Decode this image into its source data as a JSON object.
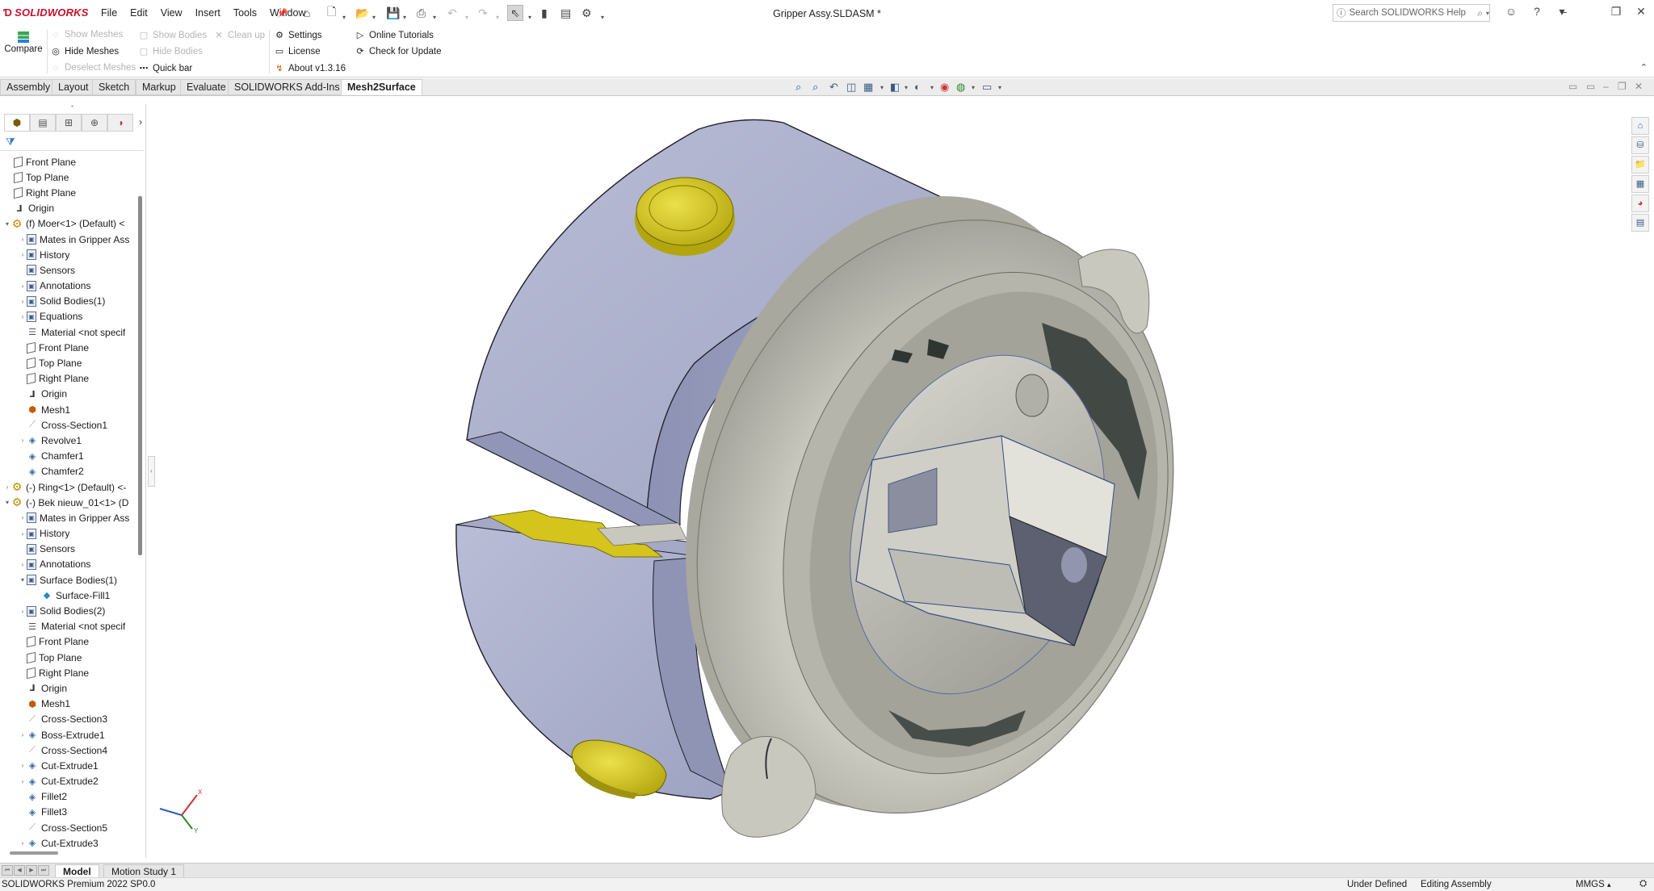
{
  "app": {
    "logo_text": "SOLIDWORKS",
    "document_title": "Gripper Assy.SLDASM *"
  },
  "menu": [
    "File",
    "Edit",
    "View",
    "Insert",
    "Tools",
    "Window"
  ],
  "search": {
    "placeholder": "Search SOLIDWORKS Help"
  },
  "ribbon": {
    "compare_label": "Compare",
    "show_meshes": "Show Meshes",
    "hide_meshes": "Hide Meshes",
    "deselect_meshes": "Deselect Meshes",
    "show_bodies": "Show Bodies",
    "hide_bodies": "Hide Bodies",
    "quick_bar": "Quick bar",
    "clean_up": "Clean up",
    "settings": "Settings",
    "license": "License",
    "about": "About v1.3.16",
    "online_tutorials": "Online Tutorials",
    "check_update": "Check for Update"
  },
  "tabs": [
    "Assembly",
    "Layout",
    "Sketch",
    "Markup",
    "Evaluate",
    "SOLIDWORKS Add-Ins",
    "Mesh2Surface"
  ],
  "active_tab": "Mesh2Surface",
  "tree": [
    {
      "label": "Front Plane",
      "icon": "plane",
      "indent": 1,
      "toggle": ""
    },
    {
      "label": "Top Plane",
      "icon": "plane",
      "indent": 1,
      "toggle": ""
    },
    {
      "label": "Right Plane",
      "icon": "plane",
      "indent": 1,
      "toggle": ""
    },
    {
      "label": "Origin",
      "icon": "origin",
      "indent": 1,
      "toggle": ""
    },
    {
      "label": "(f) Moer<1> (Default) <",
      "icon": "component",
      "indent": 0,
      "toggle": "▾"
    },
    {
      "label": "Mates in Gripper Ass",
      "icon": "folder",
      "indent": 2,
      "toggle": "›"
    },
    {
      "label": "History",
      "icon": "folder",
      "indent": 2,
      "toggle": "›"
    },
    {
      "label": "Sensors",
      "icon": "folder",
      "indent": 2,
      "toggle": ""
    },
    {
      "label": "Annotations",
      "icon": "folder",
      "indent": 2,
      "toggle": "›"
    },
    {
      "label": "Solid Bodies(1)",
      "icon": "folder",
      "indent": 2,
      "toggle": "›"
    },
    {
      "label": "Equations",
      "icon": "folder",
      "indent": 2,
      "toggle": "›"
    },
    {
      "label": "Material <not specif",
      "icon": "material",
      "indent": 2,
      "toggle": ""
    },
    {
      "label": "Front Plane",
      "icon": "plane",
      "indent": 2,
      "toggle": ""
    },
    {
      "label": "Top Plane",
      "icon": "plane",
      "indent": 2,
      "toggle": ""
    },
    {
      "label": "Right Plane",
      "icon": "plane",
      "indent": 2,
      "toggle": ""
    },
    {
      "label": "Origin",
      "icon": "origin",
      "indent": 2,
      "toggle": ""
    },
    {
      "label": "Mesh1",
      "icon": "mesh",
      "indent": 2,
      "toggle": ""
    },
    {
      "label": "Cross-Section1",
      "icon": "cross-section",
      "indent": 2,
      "toggle": ""
    },
    {
      "label": "Revolve1",
      "icon": "feature",
      "indent": 2,
      "toggle": "›"
    },
    {
      "label": "Chamfer1",
      "icon": "feature",
      "indent": 2,
      "toggle": ""
    },
    {
      "label": "Chamfer2",
      "icon": "feature",
      "indent": 2,
      "toggle": ""
    },
    {
      "label": "(-) Ring<1> (Default) <-",
      "icon": "component",
      "indent": 0,
      "toggle": "›"
    },
    {
      "label": "(-) Bek nieuw_01<1> (D",
      "icon": "component",
      "indent": 0,
      "toggle": "▾"
    },
    {
      "label": "Mates in Gripper Ass",
      "icon": "folder",
      "indent": 2,
      "toggle": "›"
    },
    {
      "label": "History",
      "icon": "folder",
      "indent": 2,
      "toggle": "›"
    },
    {
      "label": "Sensors",
      "icon": "folder",
      "indent": 2,
      "toggle": ""
    },
    {
      "label": "Annotations",
      "icon": "folder",
      "indent": 2,
      "toggle": "›"
    },
    {
      "label": "Surface Bodies(1)",
      "icon": "folder",
      "indent": 2,
      "toggle": "▾"
    },
    {
      "label": "Surface-Fill1",
      "icon": "surface",
      "indent": 3,
      "toggle": ""
    },
    {
      "label": "Solid Bodies(2)",
      "icon": "folder",
      "indent": 2,
      "toggle": "›"
    },
    {
      "label": "Material <not specif",
      "icon": "material",
      "indent": 2,
      "toggle": ""
    },
    {
      "label": "Front Plane",
      "icon": "plane",
      "indent": 2,
      "toggle": ""
    },
    {
      "label": "Top Plane",
      "icon": "plane",
      "indent": 2,
      "toggle": ""
    },
    {
      "label": "Right Plane",
      "icon": "plane",
      "indent": 2,
      "toggle": ""
    },
    {
      "label": "Origin",
      "icon": "origin",
      "indent": 2,
      "toggle": ""
    },
    {
      "label": "Mesh1",
      "icon": "mesh",
      "indent": 2,
      "toggle": ""
    },
    {
      "label": "Cross-Section3",
      "icon": "cross-section",
      "indent": 2,
      "toggle": ""
    },
    {
      "label": "Boss-Extrude1",
      "icon": "feature",
      "indent": 2,
      "toggle": "›"
    },
    {
      "label": "Cross-Section4",
      "icon": "cross-section",
      "indent": 2,
      "toggle": ""
    },
    {
      "label": "Cut-Extrude1",
      "icon": "feature",
      "indent": 2,
      "toggle": "›"
    },
    {
      "label": "Cut-Extrude2",
      "icon": "feature",
      "indent": 2,
      "toggle": "›"
    },
    {
      "label": "Fillet2",
      "icon": "feature",
      "indent": 2,
      "toggle": ""
    },
    {
      "label": "Fillet3",
      "icon": "feature",
      "indent": 2,
      "toggle": ""
    },
    {
      "label": "Cross-Section5",
      "icon": "cross-section",
      "indent": 2,
      "toggle": ""
    },
    {
      "label": "Cut-Extrude3",
      "icon": "feature",
      "indent": 2,
      "toggle": "›"
    }
  ],
  "bottom_tabs": [
    "Model",
    "Motion Study 1"
  ],
  "active_bottom_tab": "Model",
  "status": {
    "product": "SOLIDWORKS Premium 2022 SP0.0",
    "definition": "Under Defined",
    "mode": "Editing Assembly",
    "units": "MMGS"
  },
  "colors": {
    "brand": "#c8102e",
    "part_blue_gray": "#a9adc9",
    "mesh_gray": "#b8b8ae",
    "yellow_accent": "#d6c81e"
  }
}
